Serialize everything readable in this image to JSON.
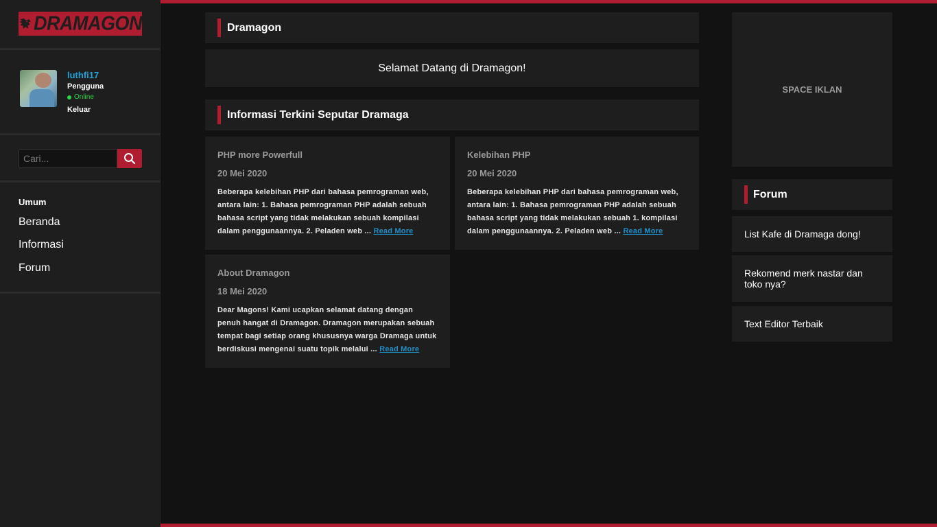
{
  "brand": {
    "logo_text": "DRAMAGON",
    "accent_color": "#b01c30"
  },
  "user": {
    "username": "luthfi17",
    "role": "Pengguna",
    "status": "Online",
    "logout_label": "Keluar"
  },
  "search": {
    "placeholder": "Cari...",
    "icon": "search-icon"
  },
  "menu": {
    "heading": "Umum",
    "items": [
      {
        "label": "Beranda"
      },
      {
        "label": "Informasi"
      },
      {
        "label": "Forum"
      }
    ]
  },
  "main": {
    "site_title": "Dramagon",
    "welcome": "Selamat Datang di Dramagon!",
    "info_title": "Informasi Terkini Seputar Dramaga",
    "read_more_label": "Read More",
    "posts": [
      {
        "title": "PHP more Powerfull",
        "date": "20 Mei 2020",
        "excerpt": "Beberapa kelebihan PHP dari bahasa pemrograman web, antara lain: 1. Bahasa pemrograman PHP adalah sebuah bahasa script yang tidak melakukan sebuah kompilasi dalam penggunaannya. 2. Peladen web ..."
      },
      {
        "title": "Kelebihan PHP",
        "date": "20 Mei 2020",
        "excerpt": "Beberapa kelebihan PHP dari bahasa pemrograman web, antara lain: 1. Bahasa pemrograman PHP adalah sebuah bahasa script yang tidak melakukan sebuah 1. kompilasi dalam penggunaannya. 2. Peladen web ..."
      },
      {
        "title": "About Dramagon",
        "date": "18 Mei 2020",
        "excerpt": "Dear Magons! Kami ucapkan selamat datang dengan penuh hangat di Dramagon. Dramagon merupakan sebuah tempat bagi setiap orang khususnya warga Dramaga untuk berdiskusi mengenai suatu topik melalui ..."
      }
    ]
  },
  "aside": {
    "ad_label": "SPACE IKLAN",
    "forum_title": "Forum",
    "forum_items": [
      {
        "label": "List Kafe di Dramaga dong!"
      },
      {
        "label": "Rekomend merk nastar dan toko nya?"
      },
      {
        "label": "Text Editor Terbaik"
      }
    ]
  }
}
